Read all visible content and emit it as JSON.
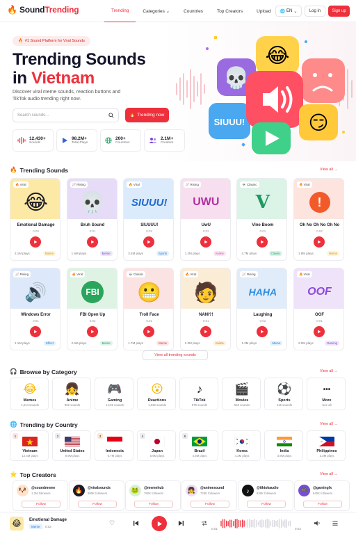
{
  "header": {
    "logo_text_a": "Sound",
    "logo_text_b": "Trending",
    "nav": [
      {
        "label": "Trending",
        "active": true
      },
      {
        "label": "Categories ⌄",
        "active": false
      },
      {
        "label": "Countries",
        "active": false
      },
      {
        "label": "Top Creators",
        "active": false
      },
      {
        "label": "Upload",
        "active": false
      }
    ],
    "lang": "EN",
    "login": "Log in",
    "signup": "Sign up"
  },
  "hero": {
    "badge": "#1 Sound Platform for Viral Sounds",
    "title_line1": "Trending Sounds",
    "title_line2_a": "in ",
    "title_line2_b": "Vietnam",
    "desc": "Discover viral meme sounds, reaction buttons and TikTok audio trending right now.",
    "search_placeholder": "Search sounds...",
    "trending_btn": "Trending now",
    "stats": [
      {
        "value": "12,430+",
        "label": "Sounds",
        "icon": "waveform-icon"
      },
      {
        "value": "98.2M+",
        "label": "Total Plays",
        "icon": "play-icon"
      },
      {
        "value": "200+",
        "label": "Countries",
        "icon": "globe-icon"
      },
      {
        "value": "2.1M+",
        "label": "Creators",
        "icon": "users-icon"
      }
    ]
  },
  "trending": {
    "title": "Trending Sounds",
    "view_all": "View all →",
    "view_all_btn": "View all trending sounds",
    "cards": [
      {
        "tag": "Viral",
        "title": "Emotional Damage",
        "dur": "0:03",
        "plays": "2.1M plays",
        "cat": "Meme",
        "art": "😂",
        "bg": "#fde9a6",
        "catc": "#fff4d6",
        "catt": "#c79410"
      },
      {
        "tag": "Rising",
        "title": "Bruh Sound",
        "dur": "0:01",
        "plays": "1.8M plays",
        "cat": "Meme",
        "art": "💀",
        "bg": "#e7dcf7",
        "catc": "#ede6fb",
        "catt": "#6b4cc0"
      },
      {
        "tag": "Viral",
        "title": "SIUUUU!",
        "dur": "0:03",
        "plays": "3.4M plays",
        "cat": "Sports",
        "art": "SIUUU!",
        "bg": "#dcebfb",
        "catc": "#e3f0fd",
        "catt": "#2e78c7"
      },
      {
        "tag": "Rising",
        "title": "UwU",
        "dur": "0:02",
        "plays": "1.2M plays",
        "cat": "Anime",
        "art": "UWU",
        "bg": "#f8dff0",
        "catc": "#fde6f2",
        "catt": "#c2439a"
      },
      {
        "tag": "Classic",
        "title": "Vine Boom",
        "dur": "0:01",
        "plays": "4.7M plays",
        "cat": "Classic",
        "art": "vine",
        "bg": "#dcf3e8",
        "catc": "#ddf5ea",
        "catt": "#1d9a61"
      },
      {
        "tag": "Viral",
        "title": "Oh No Oh No Oh No",
        "dur": "0:02",
        "plays": "1.8M plays",
        "cat": "Meme",
        "art": "!",
        "bg": "#fde4de",
        "catc": "#fff4d6",
        "catt": "#c79410"
      },
      {
        "tag": "Rising",
        "title": "Windows Error",
        "dur": "0:01",
        "plays": "1.1M plays",
        "cat": "Effect",
        "art": "speaker",
        "bg": "#dde8fb",
        "catc": "#e3f0fd",
        "catt": "#2e78c7"
      },
      {
        "tag": "Viral",
        "title": "FBI Open Up",
        "dur": "0:02",
        "plays": "2.9M plays",
        "cat": "Meme",
        "art": "FBI",
        "bg": "#dff3e4",
        "catc": "#ddf5ea",
        "catt": "#1d9a61"
      },
      {
        "tag": "Classic",
        "title": "Troll Face",
        "dur": "0:01",
        "plays": "1.7M plays",
        "cat": "Meme",
        "art": "troll",
        "bg": "#fbe3e3",
        "catc": "#fde6e6",
        "catt": "#d23a3a"
      },
      {
        "tag": "Viral",
        "title": "NANI?!",
        "dur": "0:01",
        "plays": "2.3M plays",
        "cat": "Anime",
        "art": "nani",
        "bg": "#fbecd6",
        "catc": "#fff0d9",
        "catt": "#c37a15"
      },
      {
        "tag": "Rising",
        "title": "Laughing",
        "dur": "0:02",
        "plays": "1.3M plays",
        "cat": "Meme",
        "art": "HAHA",
        "bg": "#e1ecfb",
        "catc": "#e3f0fd",
        "catt": "#2e78c7"
      },
      {
        "tag": "Viral",
        "title": "OOF",
        "dur": "0:01",
        "plays": "2.0M plays",
        "cat": "Gaming",
        "art": "OOF",
        "bg": "#efe3fa",
        "catc": "#efe6fb",
        "catt": "#7a4cc0"
      }
    ]
  },
  "categories": {
    "title": "Browse by Category",
    "view_all": "View all →",
    "items": [
      {
        "name": "Memes",
        "count": "1,314 sounds",
        "icon": "😂"
      },
      {
        "name": "Anime",
        "count": "892 sounds",
        "icon": "👧"
      },
      {
        "name": "Gaming",
        "count": "1,101 sounds",
        "icon": "🎮"
      },
      {
        "name": "Reactions",
        "count": "1,632 sounds",
        "icon": "😮"
      },
      {
        "name": "TikTok",
        "count": "876 sounds",
        "icon": "♪"
      },
      {
        "name": "Movies",
        "count": "543 sounds",
        "icon": "🎬"
      },
      {
        "name": "Sports",
        "count": "416 sounds",
        "icon": "⚽"
      },
      {
        "name": "More",
        "count": "See all",
        "icon": "•••"
      }
    ]
  },
  "countries": {
    "title": "Trending by Country",
    "view_all": "View all →",
    "items": [
      {
        "rank": "1",
        "name": "Vietnam",
        "plays": "12.4M plays",
        "flag": "vn"
      },
      {
        "rank": "2",
        "name": "United States",
        "plays": "8.9M plays",
        "flag": "us"
      },
      {
        "rank": "3",
        "name": "Indonesia",
        "plays": "6.7M plays",
        "flag": "id"
      },
      {
        "rank": "4",
        "name": "Japan",
        "plays": "5.6M plays",
        "flag": "jp"
      },
      {
        "rank": "5",
        "name": "Brazil",
        "plays": "4.8M plays",
        "flag": "br"
      },
      {
        "rank": "",
        "name": "Korea",
        "plays": "4.2M plays",
        "flag": "kr"
      },
      {
        "rank": "",
        "name": "India",
        "plays": "3.9M plays",
        "flag": "in"
      },
      {
        "rank": "",
        "name": "Philippines",
        "plays": "3.3M plays",
        "flag": "ph"
      }
    ]
  },
  "creators": {
    "title": "Top Creators",
    "view_all": "View all →",
    "follow": "Follow",
    "items": [
      {
        "handle": "@soundmeme",
        "followers": "1.2M followers",
        "icon": "🐶",
        "bg": "#fde3c8"
      },
      {
        "handle": "@viralsounds",
        "followers": "980K followers",
        "icon": "🔥",
        "bg": "#1c1c28"
      },
      {
        "handle": "@memehub",
        "followers": "760K followers",
        "icon": "🐸",
        "bg": "#d9f0d2"
      },
      {
        "handle": "@animesound",
        "followers": "720K followers",
        "icon": "👧",
        "bg": "#e9def7"
      },
      {
        "handle": "@tiktokaudio",
        "followers": "630K followers",
        "icon": "♪",
        "bg": "#111111"
      },
      {
        "handle": "@gamingfx",
        "followers": "540K followers",
        "icon": "🎮",
        "bg": "#7a4cd6"
      }
    ]
  },
  "player": {
    "title": "Emotional Damage",
    "tag": "Meme",
    "current": "0:02",
    "elapsed": "0:01",
    "total": "0:03",
    "progress": 0.35,
    "art": "😂"
  },
  "colors": {
    "accent": "#ee2f3c",
    "text": "#14142b"
  }
}
